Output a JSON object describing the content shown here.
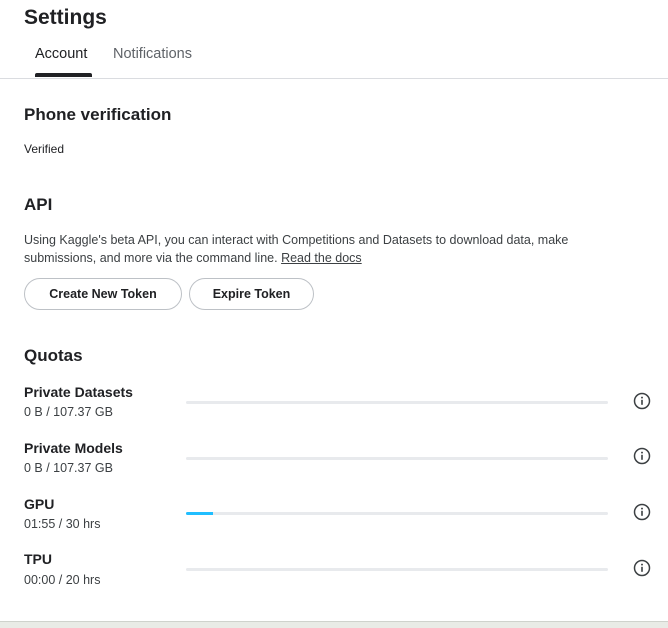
{
  "header": {
    "title": "Settings"
  },
  "tabs": [
    {
      "label": "Account",
      "active": true
    },
    {
      "label": "Notifications",
      "active": false
    }
  ],
  "phone": {
    "heading": "Phone verification",
    "status": "Verified"
  },
  "api": {
    "heading": "API",
    "description": "Using Kaggle's beta API, you can interact with Competitions and Datasets to download data, make submissions, and more via the command line.",
    "docs_link": "Read the docs",
    "create_button": "Create New Token",
    "expire_button": "Expire Token"
  },
  "quotas": {
    "heading": "Quotas",
    "items": [
      {
        "label": "Private Datasets",
        "usage": "0 B / 107.37 GB",
        "fraction": 0,
        "icon": "info-icon"
      },
      {
        "label": "Private Models",
        "usage": "0 B / 107.37 GB",
        "fraction": 0,
        "icon": "info-icon"
      },
      {
        "label": "GPU",
        "usage": "01:55 / 30 hrs",
        "fraction": 0.064,
        "icon": "info-icon"
      },
      {
        "label": "TPU",
        "usage": "00:00 / 20 hrs",
        "fraction": 0,
        "icon": "info-icon"
      }
    ]
  },
  "colors": {
    "accent": "#20beff",
    "text": "#202124",
    "track": "#e8eaed"
  }
}
